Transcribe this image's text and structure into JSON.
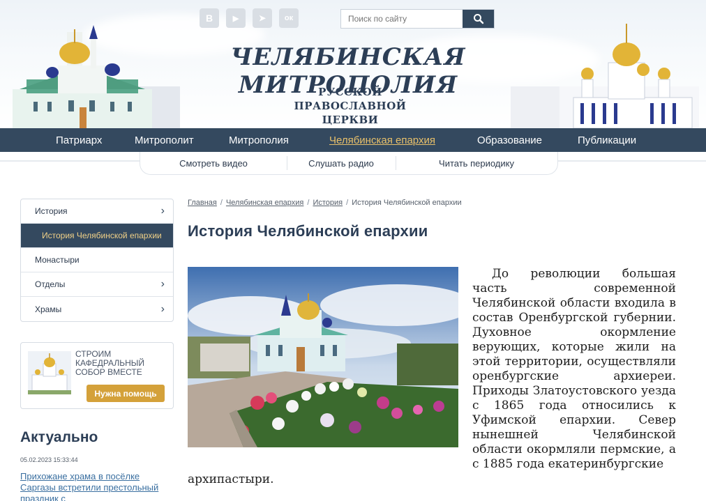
{
  "header": {
    "site_title": "ЧЕЛЯБИНСКАЯ МИТРОПОЛИЯ",
    "subtitle_line1": "РУССКОЙ",
    "subtitle_line2": "ПРАВОСЛАВНОЙ ЦЕРКВИ",
    "social": [
      {
        "name": "vk-icon",
        "glyph": "В"
      },
      {
        "name": "youtube-icon",
        "glyph": "▶"
      },
      {
        "name": "telegram-icon",
        "glyph": "➤"
      },
      {
        "name": "odnoklassniki-icon",
        "glyph": "ок"
      }
    ],
    "search": {
      "placeholder": "Поиск по сайту",
      "icon": "search-icon"
    }
  },
  "main_nav": {
    "items": [
      "Патриарх",
      "Митрополит",
      "Митрополия",
      "Челябинская епархия",
      "Образование",
      "Публикации"
    ],
    "active": "Челябинская епархия"
  },
  "sub_nav": {
    "items": [
      "Смотреть видео",
      "Слушать радио",
      "Читать периодику"
    ]
  },
  "sidebar": {
    "items": [
      {
        "label": "История",
        "has_chevron": true
      },
      {
        "label": "История Челябинской епархии",
        "active": true
      },
      {
        "label": "Монастыри",
        "has_chevron": false
      },
      {
        "label": "Отделы",
        "has_chevron": true
      },
      {
        "label": "Храмы",
        "has_chevron": true
      }
    ],
    "promo": {
      "text": "СТРОИМ КАФЕДРАЛЬНЫЙ СОБОР ВМЕСТЕ",
      "button": "Нужна помощь"
    },
    "news": {
      "heading": "Актуально",
      "date": "05.02.2023 15:33:44",
      "link": "Прихожане храма в посёлке Саргазы встретили престольный праздник с"
    }
  },
  "content": {
    "breadcrumb": [
      "Главная",
      "Челябинская епархия",
      "История",
      "История Челябинской епархии"
    ],
    "title": "История Челябинской епархии",
    "article_right": "До революции большая часть современной Челябинской области входила в состав Оренбургской губернии. Духовное окормление верующих, которые жили на этой территории, осуществляли оренбургские архиереи. Приходы Златоустовского уезда с 1865 года относились к Уфимской епархии. Север нынешней Челябинской области окормляли пермские, а с 1885 года екатеринбургские",
    "article_tail": "архипастыри."
  },
  "colors": {
    "nav_bg": "#34495f",
    "accent_gold": "#d4a13a",
    "active_link": "#e8c06a",
    "link_blue": "#3a6fa0"
  }
}
